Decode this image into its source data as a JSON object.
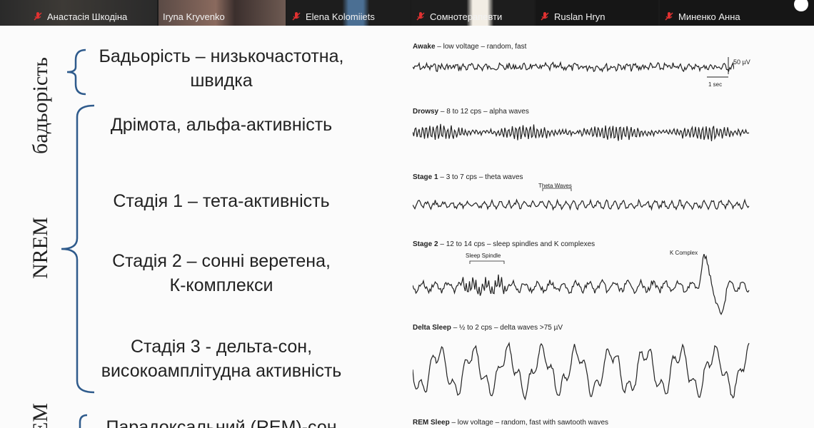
{
  "participants": [
    {
      "name": "Анастасія Шкодіна",
      "muted": true
    },
    {
      "name": "Iryna Kryvenko",
      "muted": false,
      "active": true
    },
    {
      "name": "Elena Kolomiiets",
      "muted": true
    },
    {
      "name": "Сомнотерапевти",
      "muted": true
    },
    {
      "name": "Ruslan Hryn",
      "muted": true
    },
    {
      "name": "Миненко Анна",
      "muted": true
    }
  ],
  "slide": {
    "side_labels": {
      "wake": "бадьорість",
      "nrem": "NREM",
      "rem": "REM"
    },
    "stages": [
      {
        "line1": "Бадьорість – низькочастотна,",
        "line2": "швидка"
      },
      {
        "line1": "Дрімота, альфа-активність",
        "line2": ""
      },
      {
        "line1": "Стадія 1 – тета-активність",
        "line2": ""
      },
      {
        "line1": "Стадія 2 – сонні веретена,",
        "line2": "К-комплекси"
      },
      {
        "line1": "Стадія 3 - дельта-сон,",
        "line2": "високоамплітудна активність"
      },
      {
        "line1": "Парадоксальний (REM)-сон",
        "line2": ""
      }
    ],
    "eeg": [
      {
        "title": "Awake",
        "desc": " – low voltage – random, fast",
        "scale_amp": "50 µV",
        "scale_time": "1 sec"
      },
      {
        "title": "Drowsy",
        "desc": " – 8 to 12 cps – alpha waves"
      },
      {
        "title": "Stage 1",
        "desc": " – 3 to 7 cps – theta waves",
        "annotation": "Theta Waves"
      },
      {
        "title": "Stage 2",
        "desc": " – 12 to 14 cps – sleep spindles and K complexes",
        "annotation": "Sleep Spindle",
        "annotation2": "K Complex"
      },
      {
        "title": "Delta Sleep",
        "desc": " – ½ to 2 cps – delta waves >75 µV"
      },
      {
        "title": "REM Sleep",
        "desc": " – low voltage – random, fast with sawtooth waves"
      }
    ]
  },
  "colors": {
    "active_speaker": "#3aa34a",
    "muted_mic": "#e03131",
    "strip_bg": "#1b1b1b",
    "slide_bg": "#fbfbfb"
  }
}
